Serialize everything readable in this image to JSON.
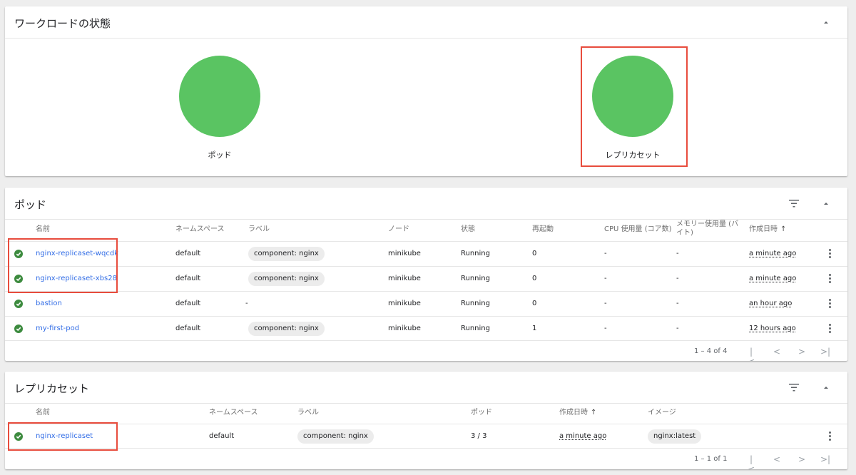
{
  "workload_status": {
    "title": "ワークロードの状態",
    "charts": [
      {
        "label": "ポッド",
        "status_color": "#5ac462"
      },
      {
        "label": "レプリカセット",
        "status_color": "#5ac462"
      }
    ]
  },
  "pods": {
    "title": "ポッド",
    "columns": [
      "名前",
      "ネームスペース",
      "ラベル",
      "ノード",
      "状態",
      "再起動",
      "CPU 使用量 (コア数)",
      "メモリー使用量 (バイト)",
      "作成日時"
    ],
    "sort_indicator": "↑",
    "rows": [
      {
        "name": "nginx-replicaset-wqcdk",
        "namespace": "default",
        "label": "component: nginx",
        "node": "minikube",
        "status": "Running",
        "restarts": "0",
        "cpu": "-",
        "memory": "-",
        "created": "a minute ago"
      },
      {
        "name": "nginx-replicaset-xbs28",
        "namespace": "default",
        "label": "component: nginx",
        "node": "minikube",
        "status": "Running",
        "restarts": "0",
        "cpu": "-",
        "memory": "-",
        "created": "a minute ago"
      },
      {
        "name": "bastion",
        "namespace": "default",
        "label": "-",
        "node": "minikube",
        "status": "Running",
        "restarts": "0",
        "cpu": "-",
        "memory": "-",
        "created": "an hour ago"
      },
      {
        "name": "my-first-pod",
        "namespace": "default",
        "label": "component: nginx",
        "node": "minikube",
        "status": "Running",
        "restarts": "1",
        "cpu": "-",
        "memory": "-",
        "created": "12 hours ago"
      }
    ],
    "pagination": "1 – 4 of 4"
  },
  "replicasets": {
    "title": "レプリカセット",
    "columns": [
      "名前",
      "ネームスペース",
      "ラベル",
      "ポッド",
      "作成日時",
      "イメージ"
    ],
    "sort_indicator": "↑",
    "rows": [
      {
        "name": "nginx-replicaset",
        "namespace": "default",
        "label": "component: nginx",
        "pods": "3 / 3",
        "created": "a minute ago",
        "image": "nginx:latest"
      }
    ],
    "pagination": "1 – 1 of 1"
  },
  "pager_icons": [
    "first-page-icon",
    "prev-page-icon",
    "next-page-icon",
    "last-page-icon"
  ],
  "colors": {
    "success": "#3d8b3f",
    "chart": "#5ac462",
    "link": "#326de6",
    "highlight": "#e84c3d"
  }
}
